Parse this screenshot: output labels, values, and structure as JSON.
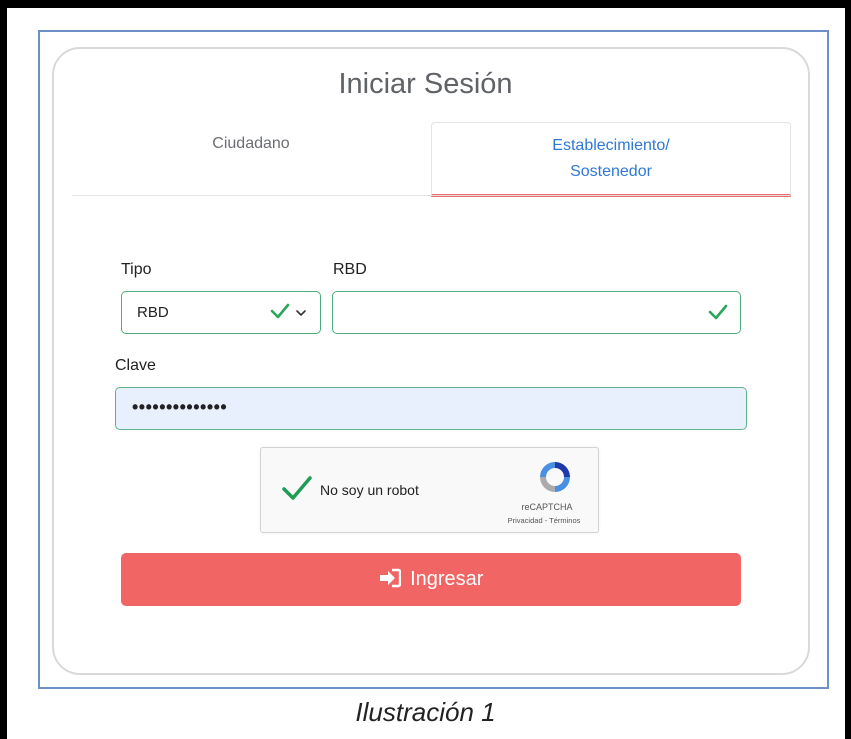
{
  "title": "Iniciar Sesión",
  "tabs": [
    {
      "label": "Ciudadano",
      "active": false
    },
    {
      "label_line1": "Establecimiento/",
      "label_line2": "Sostenedor",
      "active": true
    }
  ],
  "form": {
    "tipo_label": "Tipo",
    "tipo_value": "RBD",
    "rbd_label": "RBD",
    "rbd_value": "",
    "clave_label": "Clave",
    "clave_value": "••••••••••••••"
  },
  "captcha": {
    "text": "No soy un robot",
    "brand": "reCAPTCHA",
    "links": "Privacidad - Términos",
    "checked": true
  },
  "submit_label": "Ingresar",
  "caption": "Ilustración 1",
  "colors": {
    "accent_red": "#f26565",
    "valid_green": "#2aa65a",
    "tab_blue": "#2e78d4",
    "frame_blue": "#6f8fc9"
  },
  "icons": [
    "check-icon",
    "chevron-down-icon",
    "sign-in-icon",
    "recaptcha-logo-icon"
  ]
}
